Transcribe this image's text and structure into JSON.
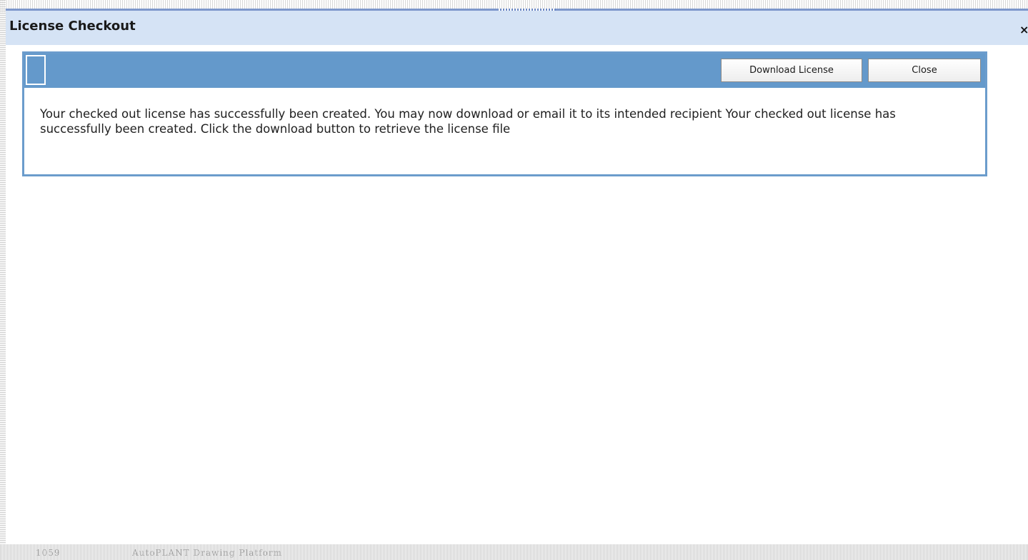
{
  "dialog": {
    "title": "License Checkout",
    "close_glyph": "×",
    "close_icon": "close-icon"
  },
  "toolbar": {
    "download_label": "Download License",
    "close_label": "Close"
  },
  "message": "Your checked out license has successfully been created. You may now download or email it to its intended recipient Your checked out license has successfully been created. Click the download button to retrieve the license file",
  "background": {
    "row_id": "1059",
    "row_name": "AutoPLANT Drawing Platform"
  },
  "colors": {
    "title_bar": "#d5e3f5",
    "toolbar": "#6499cb",
    "panel_border": "#6b9ccc"
  }
}
